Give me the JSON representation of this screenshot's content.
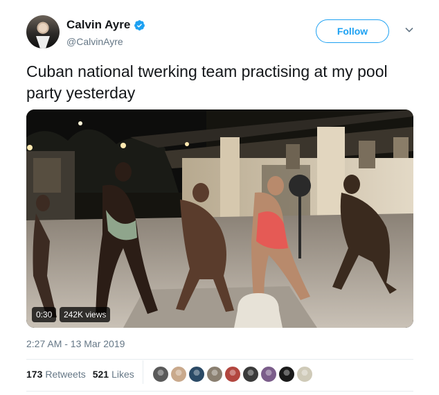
{
  "user": {
    "name": "Calvin Ayre",
    "handle": "@CalvinAyre"
  },
  "follow_label": "Follow",
  "tweet_text": "Cuban national twerking team practising at my pool party yesterday",
  "video": {
    "duration": "0:30",
    "views": "242K views"
  },
  "timestamp": "2:27 AM - 13 Mar 2019",
  "stats": {
    "retweets_count": "173",
    "retweets_label": "Retweets",
    "likes_count": "521",
    "likes_label": "Likes"
  },
  "liker_avatars": [
    "#5a5a5a",
    "#c9a98c",
    "#2b4a66",
    "#8a7f70",
    "#b2463f",
    "#3a3a3a",
    "#7b5d8a",
    "#1a1a1a",
    "#cfcab8"
  ],
  "colors": {
    "accent": "#1da1f2",
    "text": "#14171a",
    "secondary": "#657786",
    "divider": "#e6ecf0"
  },
  "icons": [
    "verified-badge-icon",
    "chevron-down-icon"
  ]
}
